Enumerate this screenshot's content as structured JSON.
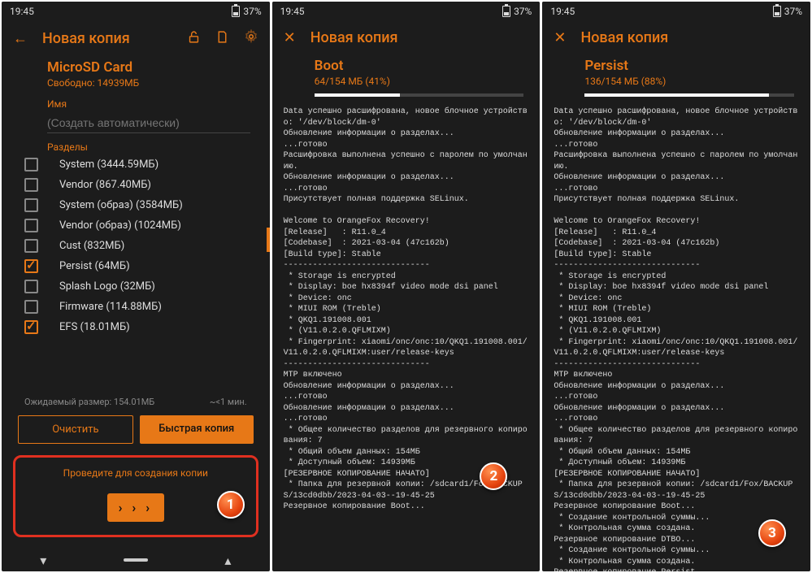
{
  "status": {
    "time": "19:45",
    "battery": "37%"
  },
  "p1": {
    "title": "Новая копия",
    "storage_title": "MicroSD Card",
    "storage_free": "Свободно: 14939МБ",
    "name_label": "Имя",
    "name_placeholder": "(Создать автоматически)",
    "partitions_label": "Разделы",
    "partitions": [
      {
        "name": "System (3444.59МБ)",
        "checked": false
      },
      {
        "name": "Vendor (867.40МБ)",
        "checked": false
      },
      {
        "name": "System (образ) (3584МБ)",
        "checked": false
      },
      {
        "name": "Vendor (образ) (1024МБ)",
        "checked": false
      },
      {
        "name": "Cust (832МБ)",
        "checked": false
      },
      {
        "name": "Persist (64МБ)",
        "checked": true
      },
      {
        "name": "Splash Logo (32МБ)",
        "checked": false
      },
      {
        "name": "Firmware (114.88МБ)",
        "checked": false
      },
      {
        "name": "EFS (18.01МБ)",
        "checked": true
      }
    ],
    "expected_label": "Ожидаемый размер:  154.01МБ",
    "expected_time": "~<1 мин.",
    "clear_btn": "Очистить",
    "fast_btn": "Быстрая копия",
    "swipe_label": "Проведите для создания копии",
    "swipe_chev": "› › ›"
  },
  "p2": {
    "title": "Новая копия",
    "section": "Boot",
    "progress_text": "64/154 МБ (41%)",
    "progress_pct": 41,
    "terminal": "Data успешно расшифрована, новое блочное устройство: '/dev/block/dm-0'\nОбновление информации о разделах...\n...готово\nРасшифровка выполнена успешно с паролем по умолчанию.\nОбновление информации о разделах...\n...готово\nПрисутствует полная поддержка SELinux.\n\nWelcome to OrangeFox Recovery!\n[Release]   : R11.0_4\n[Codebase]  : 2021-03-04 (47c162b)\n[Build type]: Stable\n------------------------------\n * Storage is encrypted\n * Display: boe hx8394f video mode dsi panel\n * Device: onc\n * MIUI ROM (Treble)\n * QKQ1.191008.001\n * (V11.0.2.0.QFLMIXM)\n * Fingerprint: xiaomi/onc/onc:10/QKQ1.191008.001/V11.0.2.0.QFLMIXM:user/release-keys\n------------------------------\nМТР включено\nОбновление информации о разделах...\n...готово\nОбновление информации о разделах...\n...готово\n * Общее количество разделов для резервного копирования: 7\n * Общий объем данных: 154МБ\n * Доступный объем: 14939МБ\n[РЕЗЕРВНОЕ КОПИРОВАНИЕ НАЧАТО]\n * Папка для резервной копии: /sdcard1/Fox/BACKUPS/13cd0dbb/2023-04-03--19-45-25\nРезервное копирование Boot..."
  },
  "p3": {
    "title": "Новая копия",
    "section": "Persist",
    "progress_text": "136/154 МБ (88%)",
    "progress_pct": 88,
    "terminal": "Data успешно расшифрована, новое блочное устройство: '/dev/block/dm-0'\nОбновление информации о разделах...\n...готово\nРасшифровка выполнена успешно с паролем по умолчанию.\nОбновление информации о разделах...\n...готово\nПрисутствует полная поддержка SELinux.\n\nWelcome to OrangeFox Recovery!\n[Release]   : R11.0_4\n[Codebase]  : 2021-03-04 (47c162b)\n[Build type]: Stable\n------------------------------\n * Storage is encrypted\n * Display: boe hx8394f video mode dsi panel\n * Device: onc\n * MIUI ROM (Treble)\n * QKQ1.191008.001\n * (V11.0.2.0.QFLMIXM)\n * Fingerprint: xiaomi/onc/onc:10/QKQ1.191008.001/V11.0.2.0.QFLMIXM:user/release-keys\n------------------------------\nМТР включено\nОбновление информации о разделах...\n...готово\nОбновление информации о разделах...\n...готово\n * Общее количество разделов для резервного копирования: 7\n * Общий объем данных: 154МБ\n * Доступный объем: 14939МБ\n[РЕЗЕРВНОЕ КОПИРОВАНИЕ НАЧАТО]\n * Папка для резервной копии: /sdcard1/Fox/BACKUPS/13cd0dbb/2023-04-03--19-45-25\nРезервное копирование Boot...\n * Создание контрольной суммы...\n * Контрольная сумма создана.\nРезервное копирование DTBO...\n * Создание контрольной суммы...\n * Контрольная сумма создана.\nРезервное копирование Persist...\n * Создание контрольной суммы..."
  },
  "badges": {
    "b1": "1",
    "b2": "2",
    "b3": "3"
  }
}
